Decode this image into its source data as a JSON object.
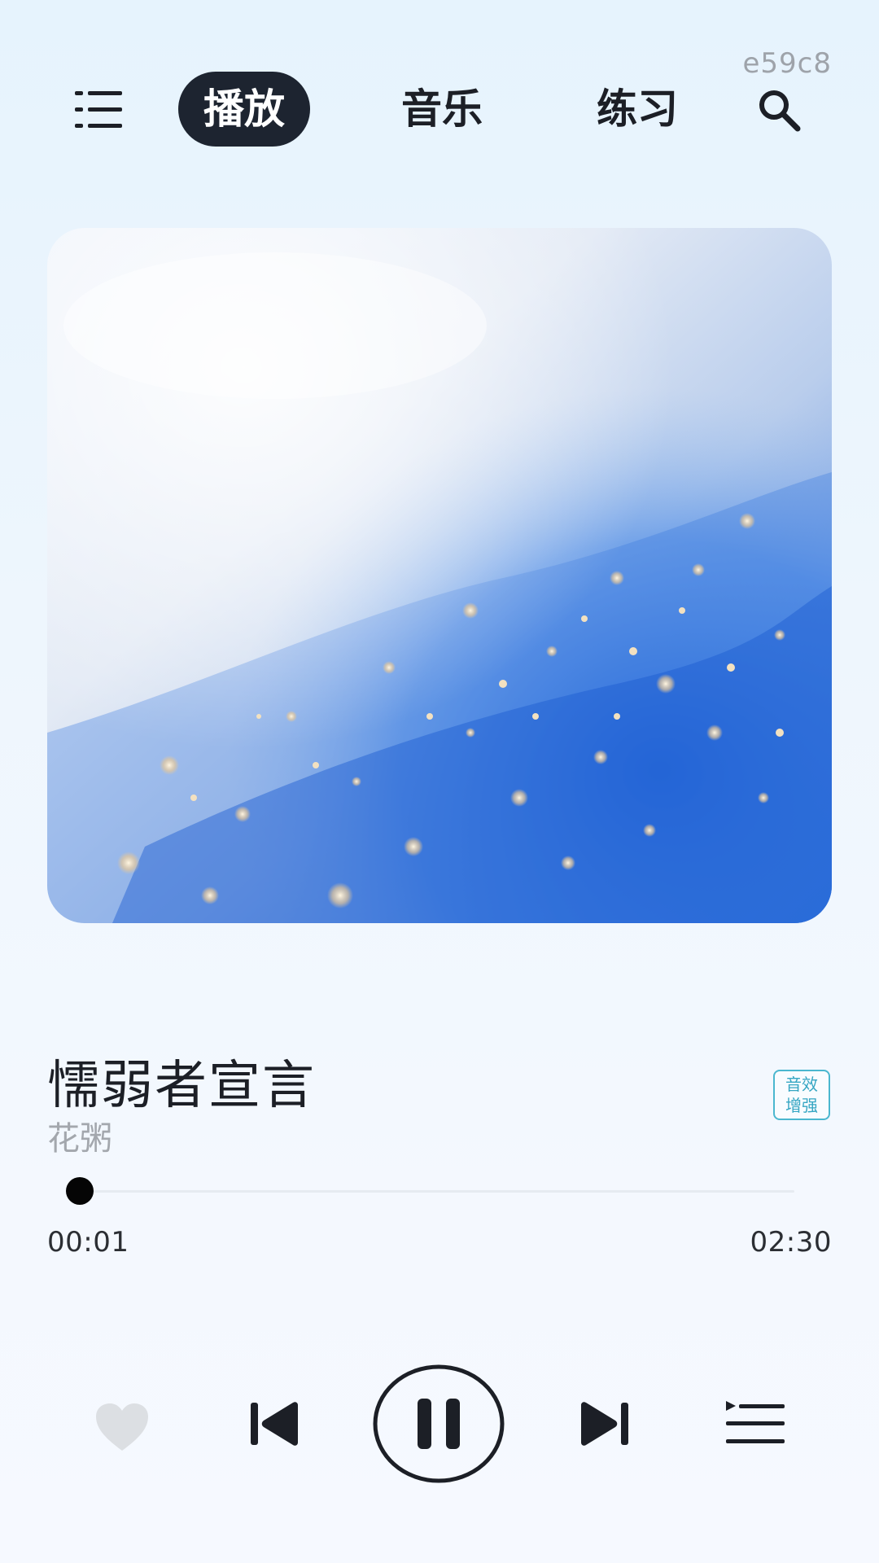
{
  "top_right_code": "e59c8",
  "nav": {
    "tabs": [
      {
        "label": "播放",
        "active": true
      },
      {
        "label": "音乐",
        "active": false
      },
      {
        "label": "练习",
        "active": false
      }
    ],
    "menu_icon": "menu-icon",
    "search_icon": "search-icon"
  },
  "song": {
    "title": "懦弱者宣言",
    "artist": "花粥",
    "badge_line1": "音效",
    "badge_line2": "增强"
  },
  "progress": {
    "current_time": "00:01",
    "total_time": "02:30",
    "fraction": 0.007
  },
  "controls": {
    "like_icon": "heart-icon",
    "prev_icon": "previous-icon",
    "play_state": "playing",
    "play_icon": "pause-icon",
    "next_icon": "next-icon",
    "playlist_icon": "playlist-icon"
  },
  "colors": {
    "accent_dark": "#1d2430",
    "badge": "#36a6c3",
    "muted_text": "#a3a7ad"
  }
}
